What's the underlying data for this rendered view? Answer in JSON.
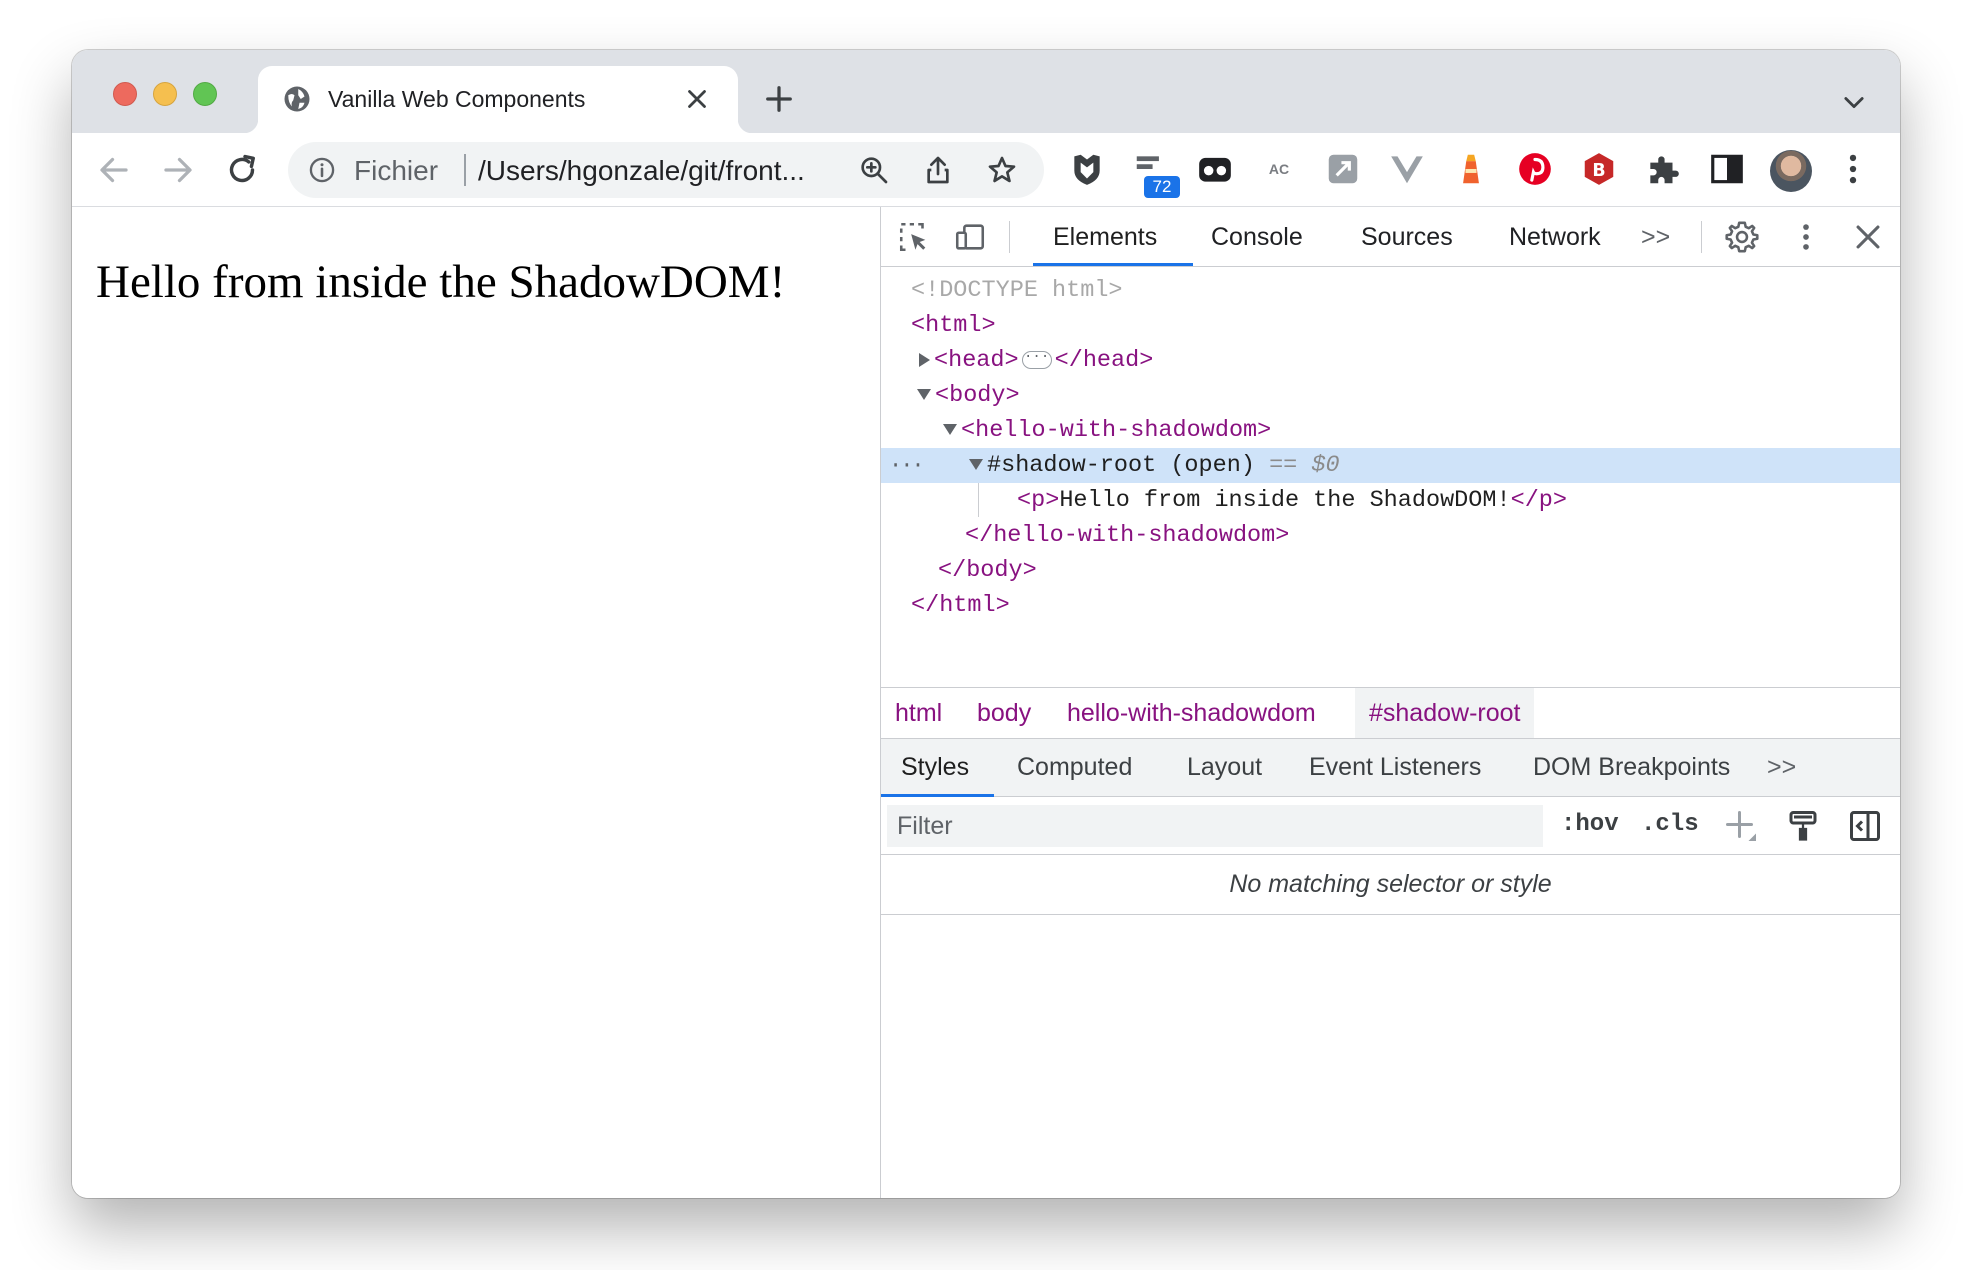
{
  "browser": {
    "tab": {
      "title": "Vanilla Web Components"
    },
    "omnibox": {
      "scheme_label": "Fichier",
      "url": "/Users/hgonzale/git/front..."
    },
    "extensions": {
      "badge_count": "72",
      "ac_label": "AC",
      "b_label": "B"
    }
  },
  "page": {
    "text": "Hello from inside the ShadowDOM!"
  },
  "devtools": {
    "tabs": [
      "Elements",
      "Console",
      "Sources",
      "Network"
    ],
    "more_tabs": ">>",
    "tree": {
      "doctype": "<!DOCTYPE html>",
      "html_open": "<html>",
      "head_open": "<head>",
      "head_close": "</head>",
      "body_open": "<body>",
      "component_open": "<hello-with-shadowdom>",
      "shadow_root": "#shadow-root (open)",
      "selected_marker": "== $0",
      "p_open": "<p>",
      "p_text": "Hello from inside the ShadowDOM!",
      "p_close": "</p>",
      "component_close": "</hello-with-shadowdom>",
      "body_close": "</body>",
      "html_close": "</html>",
      "row_dots": "···"
    },
    "breadcrumbs": [
      "html",
      "body",
      "hello-with-shadowdom",
      "#shadow-root"
    ],
    "styles_tabs": [
      "Styles",
      "Computed",
      "Layout",
      "Event Listeners",
      "DOM Breakpoints"
    ],
    "styles_more": ">>",
    "filter": {
      "placeholder": "Filter",
      "hov": ":hov",
      "cls": ".cls"
    },
    "no_match": "No matching selector or style"
  },
  "colors": {
    "accent": "#1a73e8",
    "tag": "#881280",
    "selected_row": "#cfe3f9"
  }
}
